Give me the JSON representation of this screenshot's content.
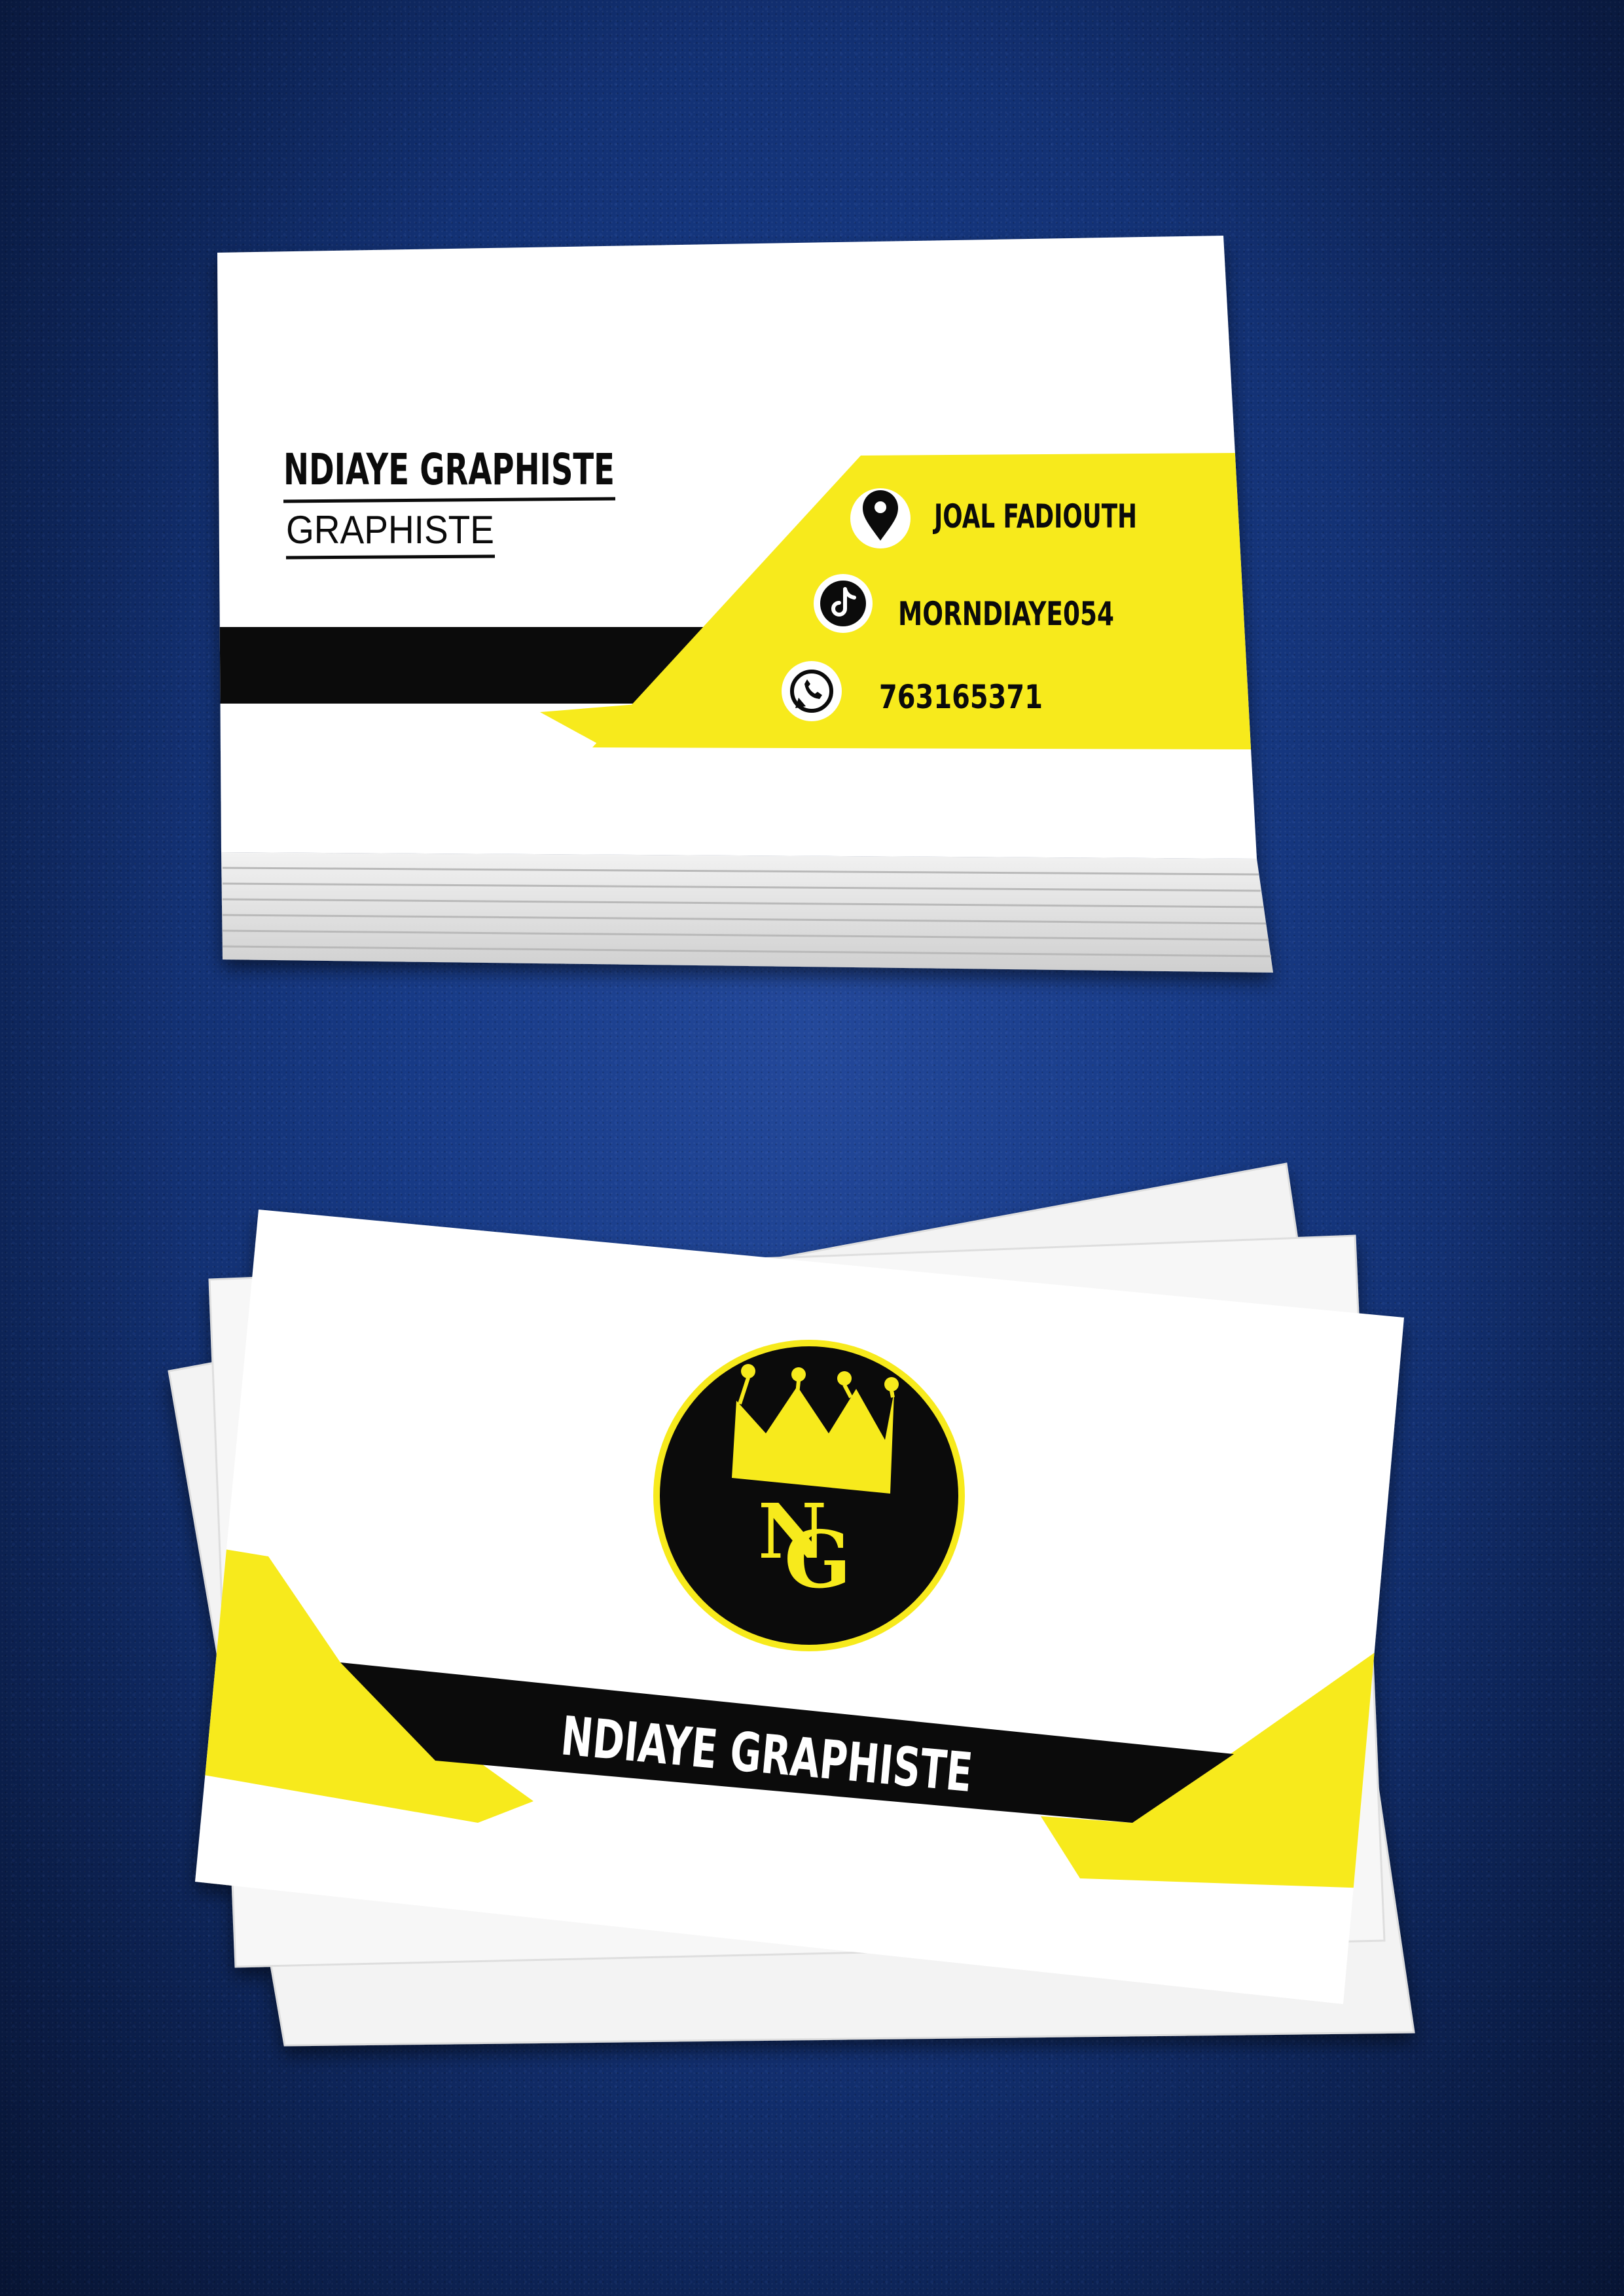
{
  "front_card": {
    "name": "NDIAYE GRAPHISTE",
    "title": "GRAPHISTE",
    "contacts": [
      {
        "icon": "location-pin-icon",
        "text": "JOAL FADIOUTH"
      },
      {
        "icon": "tiktok-icon",
        "text": "MORNDIAYE054"
      },
      {
        "icon": "whatsapp-icon",
        "text": "763165371"
      }
    ]
  },
  "back_card": {
    "logo_letters": [
      "N",
      "G"
    ],
    "banner_text": "NDIAYE GRAPHISTE"
  },
  "colors": {
    "yellow": "#f7ea1c",
    "black": "#0b0b0b",
    "white": "#ffffff",
    "background": "#173a86"
  }
}
